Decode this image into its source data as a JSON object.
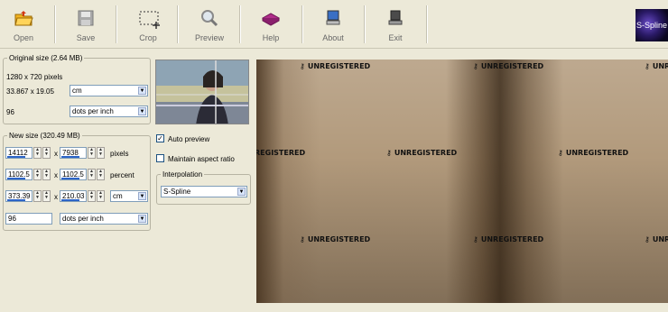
{
  "toolbar": {
    "open": "Open",
    "save": "Save",
    "crop": "Crop",
    "preview": "Preview",
    "help": "Help",
    "about": "About",
    "exit": "Exit",
    "logo": "S-Spline"
  },
  "original": {
    "legend": "Original size (2.64 MB)",
    "pixels": "1280 x 720 pixels",
    "dims": "33.867 x 19.05",
    "unit": "cm",
    "res": "96",
    "res_unit": "dots per inch"
  },
  "new_size": {
    "legend": "New size (320.49 MB)",
    "width_px": "14112",
    "height_px": "7938",
    "pixels_label": "pixels",
    "width_pct": "1102.5",
    "height_pct": "1102.5",
    "percent_label": "percent",
    "width_unit": "373.39",
    "height_unit": "210.03",
    "unit": "cm",
    "res": "96",
    "res_unit": "dots per inch",
    "x": "x"
  },
  "options": {
    "auto_preview": "Auto preview",
    "auto_preview_checked": true,
    "maintain_ratio": "Maintain aspect ratio",
    "maintain_ratio_checked": false
  },
  "interpolation": {
    "legend": "Interpolation",
    "value": "S-Spline"
  },
  "watermark": "UNREGISTERED",
  "watermark_partial": "REGISTERED"
}
